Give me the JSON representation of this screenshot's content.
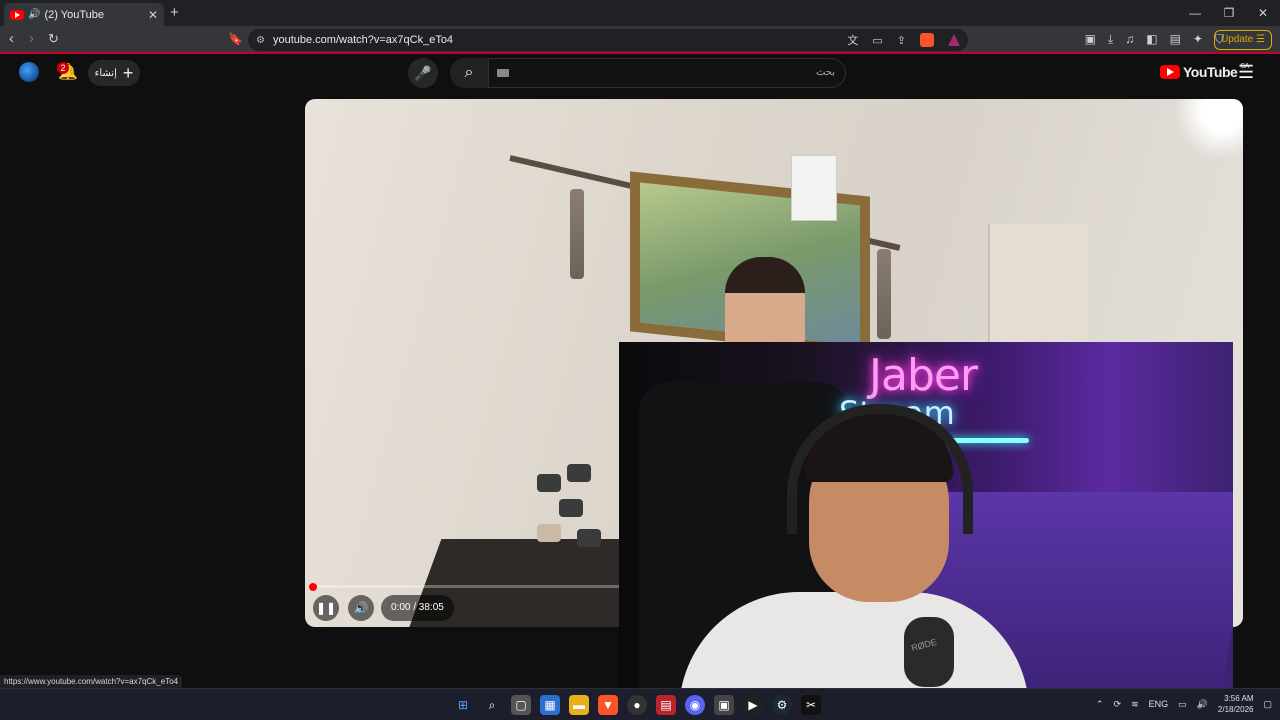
{
  "browser": {
    "tab_title": "(2) YouTube",
    "tab_close": "✕",
    "new_tab": "+",
    "url": "youtube.com/watch?v=ax7qCk_eTo4",
    "update_label": "Update",
    "status_url": "https://www.youtube.com/watch?v=ax7qCk_eTo4"
  },
  "youtube": {
    "notification_count": "2",
    "create_label": "إنشاء",
    "search_placeholder": "بحث",
    "logo_text": "YouTube",
    "region": "SA"
  },
  "player": {
    "time_display": "0:00 / 38:05",
    "progress": 0.0,
    "state": "playing"
  },
  "stream_overlay": {
    "neon_line1": "Jaber",
    "neon_line2": "Stream",
    "mic_brand": "RØDE"
  },
  "taskbar": {
    "language": "ENG",
    "time": "3:56 AM",
    "date": "2/18/2026"
  },
  "colors": {
    "accent_red": "#ff0000",
    "update_yellow": "#e0a800"
  }
}
